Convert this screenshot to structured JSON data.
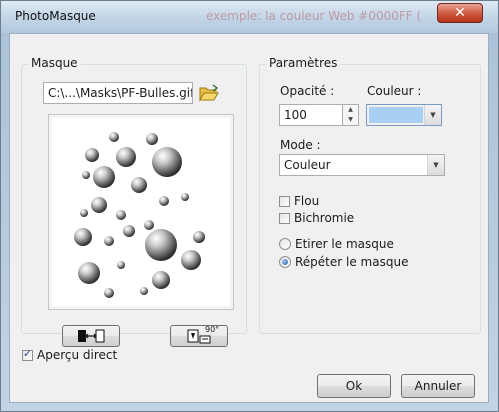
{
  "window": {
    "title": "PhotoMasque",
    "ghost_title": "exemple: la couleur Web #0000FF (",
    "close_icon": "close-icon"
  },
  "masque": {
    "group_label": "Masque",
    "file_value": "C:\\...\\Masks\\PF-Bulles.gif",
    "browse_icon": "folder-open-icon",
    "flip_button_icon": "flip-horizontal-icon",
    "rotate_button_icon": "rotate-90-icon",
    "rotate_label": "90°"
  },
  "parametres": {
    "group_label": "Paramètres",
    "opacite_label": "Opacité :",
    "opacite_value": "100",
    "couleur_label": "Couleur :",
    "couleur_color": "#a9cff3",
    "mode_label": "Mode :",
    "mode_value": "Couleur",
    "flou_label": "Flou",
    "flou_checked": false,
    "bichromie_label": "Bichromie",
    "bichromie_checked": false,
    "etirer_label": "Etirer le masque",
    "repeter_label": "Répéter le masque",
    "selected_option": "Répéter le masque"
  },
  "footer": {
    "apercu_label": "Aperçu direct",
    "apercu_checked": true,
    "ok_label": "Ok",
    "annuler_label": "Annuler"
  }
}
